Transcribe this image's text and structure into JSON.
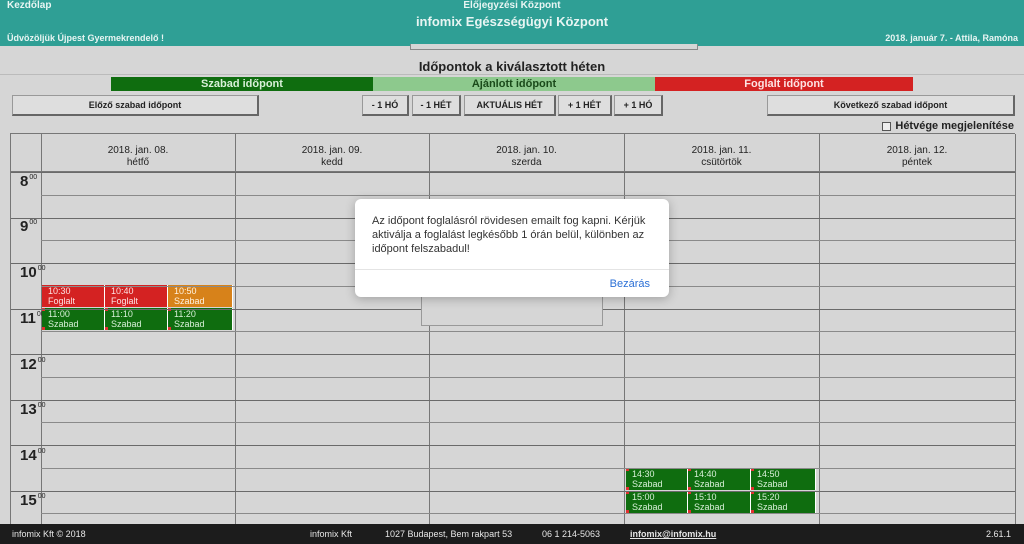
{
  "header": {
    "home_link": "Kezdőlap",
    "subtitle": "Előjegyzési Központ",
    "title": "infomix Egészségügyi Központ",
    "welcome": "Üdvözöljük Újpest Gyermekrendelő !",
    "user_info": "2018. január 7. - Attila, Ramóna"
  },
  "week_title": "Időpontok a kiválasztott héten",
  "legend": {
    "free": "Szabad időpont",
    "recommended": "Ajánlott időpont",
    "busy": "Foglalt időpont"
  },
  "nav": {
    "prev_free": "Előző szabad időpont",
    "minus_month": "- 1 HÓ",
    "minus_week": "- 1 HÉT",
    "current_week": "AKTUÁLIS HÉT",
    "plus_week": "+ 1 HÉT",
    "plus_month": "+ 1 HÓ",
    "next_free": "Következő szabad időpont"
  },
  "weekend_toggle": "Hétvége megjelenítése",
  "days": [
    {
      "date": "2018. jan. 08.",
      "name": "hétfő"
    },
    {
      "date": "2018. jan. 09.",
      "name": "kedd"
    },
    {
      "date": "2018. jan. 10.",
      "name": "szerda"
    },
    {
      "date": "2018. jan. 11.",
      "name": "csütörtök"
    },
    {
      "date": "2018. jan. 12.",
      "name": "péntek"
    }
  ],
  "hours": [
    "8",
    "9",
    "10",
    "11",
    "12",
    "13",
    "14",
    "15"
  ],
  "minutes_label": "00",
  "slots": {
    "mon": [
      {
        "time": "10:30",
        "status": "Foglalt időpont"
      },
      {
        "time": "10:40",
        "status": "Foglalt időpont"
      },
      {
        "time": "10:50",
        "status": "Szabad"
      },
      {
        "time": "11:00",
        "status": "Szabad"
      },
      {
        "time": "11:10",
        "status": "Szabad"
      },
      {
        "time": "11:20",
        "status": "Szabad"
      }
    ],
    "thu": [
      {
        "time": "14:30",
        "status": "Szabad"
      },
      {
        "time": "14:40",
        "status": "Szabad"
      },
      {
        "time": "14:50",
        "status": "Szabad"
      },
      {
        "time": "15:00",
        "status": "Szabad"
      },
      {
        "time": "15:10",
        "status": "Szabad"
      },
      {
        "time": "15:20",
        "status": "Szabad"
      }
    ]
  },
  "modal": {
    "message": "Az időpont foglalásról rövidesen emailt fog kapni. Kérjük aktiválja a foglalást legkésőbb 1 órán belül, különben az időpont felszabadul!",
    "close": "Bezárás"
  },
  "footer": {
    "copyright": "infomix Kft © 2018",
    "company": "infomix Kft",
    "address": "1027 Budapest, Bem rakpart 53",
    "phone": "06 1 214-5063",
    "email": "infomix@infomix.hu",
    "version": "2.61.1"
  },
  "colors": {
    "header": "#2f9f95",
    "free": "#0f6d0f",
    "recommended": "#8dc98d",
    "busy": "#d42222",
    "pending": "#d7821a"
  }
}
